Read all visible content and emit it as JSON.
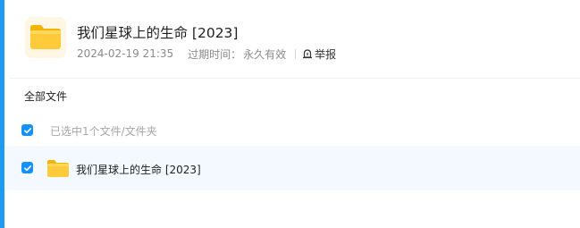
{
  "share": {
    "title": "我们星球上的生命 [2023]",
    "date": "2024-02-19 21:35",
    "expiry_label": "过期时间：",
    "expiry_value": "永久有效",
    "report_label": "举报"
  },
  "breadcrumb": {
    "root_label": "全部文件"
  },
  "selection": {
    "status_text": "已选中1个文件/文件夹",
    "checked": true
  },
  "files": [
    {
      "name": "我们星球上的生命 [2023]",
      "type": "folder",
      "checked": true
    }
  ],
  "colors": {
    "accent": "#1591ff",
    "sidebar_accent": "#1e9bf0",
    "selected_row": "#f3f9ff",
    "folder": "#ffc830"
  }
}
